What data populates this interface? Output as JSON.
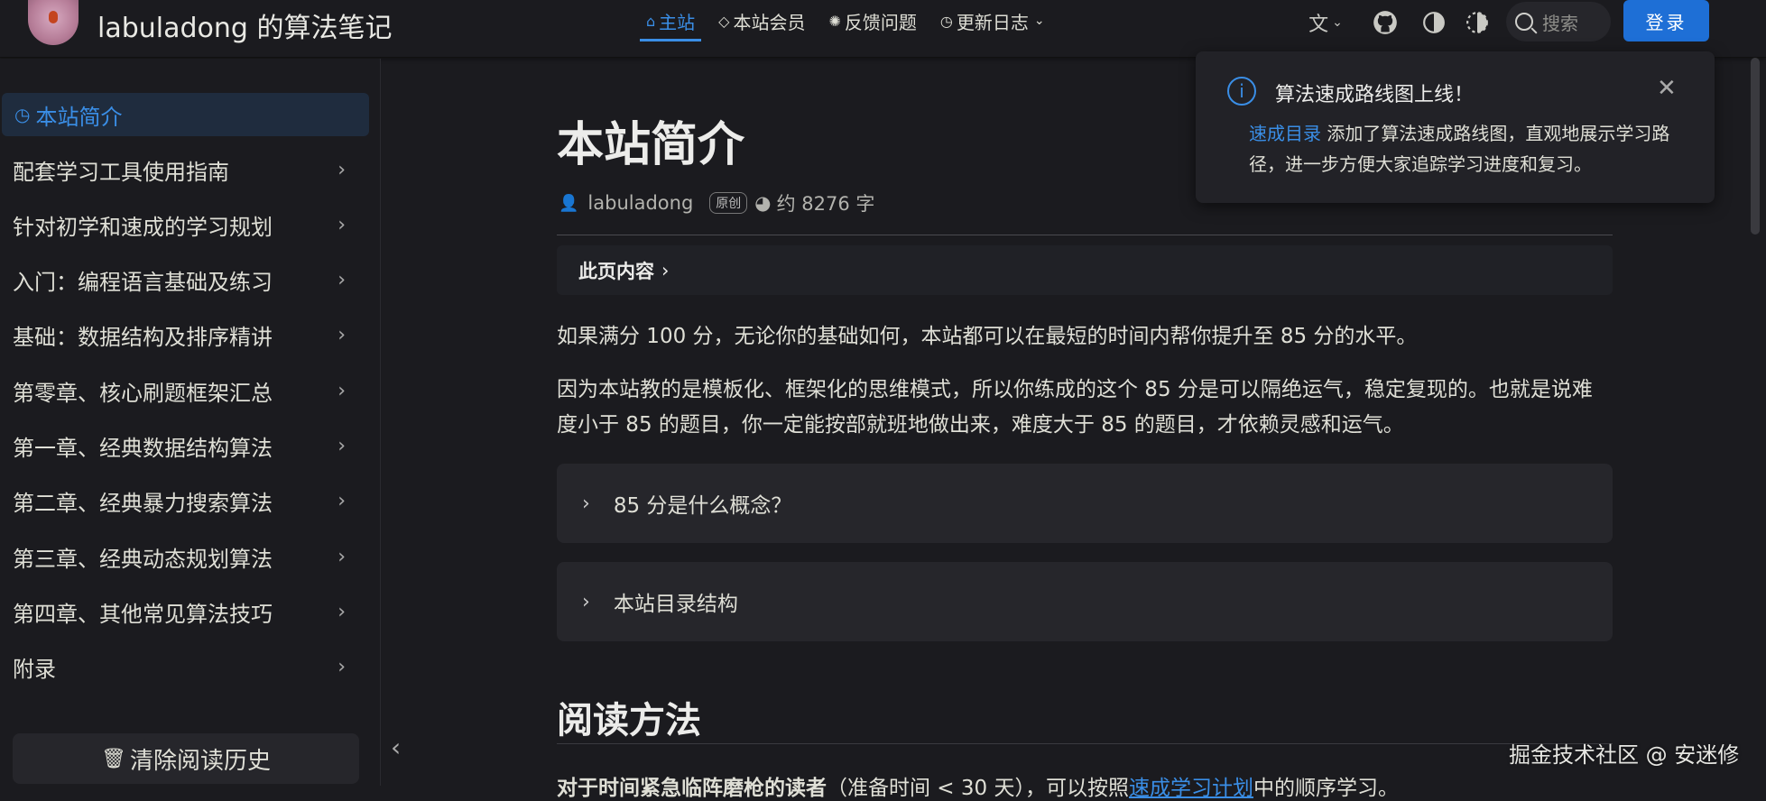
{
  "header": {
    "site_title": "labuladong 的算法笔记",
    "nav": [
      {
        "icon": "home-icon",
        "label": "主站"
      },
      {
        "icon": "diamond-icon",
        "label": "本站会员"
      },
      {
        "icon": "bug-icon",
        "label": "反馈问题"
      },
      {
        "icon": "clock-icon",
        "label": "更新日志"
      }
    ],
    "search_placeholder": "搜索",
    "login_label": "登录"
  },
  "sidebar": {
    "items": [
      {
        "label": "本站简介",
        "active": true
      },
      {
        "label": "配套学习工具使用指南"
      },
      {
        "label": "针对初学和速成的学习规划"
      },
      {
        "label": "入门：编程语言基础及练习"
      },
      {
        "label": "基础：数据结构及排序精讲"
      },
      {
        "label": "第零章、核心刷题框架汇总"
      },
      {
        "label": "第一章、经典数据结构算法"
      },
      {
        "label": "第二章、经典暴力搜索算法"
      },
      {
        "label": "第三章、经典动态规划算法"
      },
      {
        "label": "第四章、其他常见算法技巧"
      },
      {
        "label": "附录"
      }
    ],
    "clear_history_label": "清除阅读历史"
  },
  "article": {
    "title": "本站简介",
    "author": "labuladong",
    "badge": "原创",
    "word_count": "约 8276 字",
    "toc_label": "此页内容",
    "para1": "如果满分 100 分，无论你的基础如何，本站都可以在最短的时间内帮你提升至 85 分的水平。",
    "para2": "因为本站教的是模板化、框架化的思维模式，所以你练成的这个 85 分是可以隔绝运气，稳定复现的。也就是说难度小于 85 的题目，你一定能按部就班地做出来，难度大于 85 的题目，才依赖灵感和运气。",
    "details": [
      {
        "label": "85 分是什么概念？"
      },
      {
        "label": "本站目录结构"
      }
    ],
    "section_title": "阅读方法",
    "last_line_bold": "对于时间紧急临阵磨枪的读者",
    "last_line_text": "（准备时间 < 30 天），可以按照",
    "last_line_link": "速成学习计划",
    "last_line_tail": "中的顺序学习。"
  },
  "toast": {
    "title": "算法速成路线图上线！",
    "link": "速成目录",
    "body": " 添加了算法速成路线图，直观地展示学习路径，进一步方便大家追踪学习进度和复习。"
  },
  "watermark": "掘金技术社区 @ 安迷修"
}
